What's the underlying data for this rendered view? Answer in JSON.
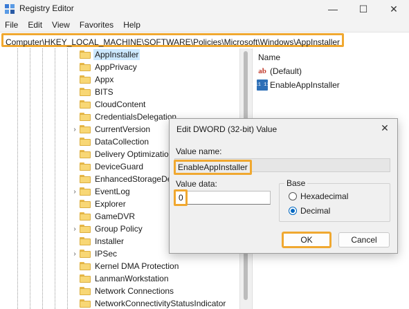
{
  "window": {
    "title": "Registry Editor",
    "minimize_glyph": "—",
    "maximize_glyph": "☐",
    "close_glyph": "✕",
    "icon": "registry-editor-icon"
  },
  "menu": [
    "File",
    "Edit",
    "View",
    "Favorites",
    "Help"
  ],
  "address": "Computer\\HKEY_LOCAL_MACHINE\\SOFTWARE\\Policies\\Microsoft\\Windows\\AppInstaller",
  "tree": {
    "items": [
      {
        "label": "AppInstaller",
        "expander": "",
        "selected": true
      },
      {
        "label": "AppPrivacy",
        "expander": ""
      },
      {
        "label": "Appx",
        "expander": ""
      },
      {
        "label": "BITS",
        "expander": ""
      },
      {
        "label": "CloudContent",
        "expander": ""
      },
      {
        "label": "CredentialsDelegation",
        "expander": ""
      },
      {
        "label": "CurrentVersion",
        "expander": "›"
      },
      {
        "label": "DataCollection",
        "expander": ""
      },
      {
        "label": "Delivery Optimization",
        "expander": ""
      },
      {
        "label": "DeviceGuard",
        "expander": ""
      },
      {
        "label": "EnhancedStorageDevices",
        "expander": ""
      },
      {
        "label": "EventLog",
        "expander": "›"
      },
      {
        "label": "Explorer",
        "expander": ""
      },
      {
        "label": "GameDVR",
        "expander": ""
      },
      {
        "label": "Group Policy",
        "expander": "›"
      },
      {
        "label": "Installer",
        "expander": ""
      },
      {
        "label": "IPSec",
        "expander": "›"
      },
      {
        "label": "Kernel DMA Protection",
        "expander": ""
      },
      {
        "label": "LanmanWorkstation",
        "expander": ""
      },
      {
        "label": "Network Connections",
        "expander": ""
      },
      {
        "label": "NetworkConnectivityStatusIndicator",
        "expander": ""
      }
    ]
  },
  "values": {
    "column_name": "Name",
    "rows": [
      {
        "name": "(Default)",
        "type_icon": "ab",
        "type": "string"
      },
      {
        "name": "EnableAppInstaller",
        "type_icon": "011 110",
        "type": "dword"
      }
    ]
  },
  "dialog": {
    "title": "Edit DWORD (32-bit) Value",
    "close_glyph": "✕",
    "value_name_label": "Value name:",
    "value_name": "EnableAppInstaller",
    "value_data_label": "Value data:",
    "value_data": "0",
    "base_label": "Base",
    "base_options": [
      {
        "label": "Hexadecimal",
        "checked": false
      },
      {
        "label": "Decimal",
        "checked": true
      }
    ],
    "ok_label": "OK",
    "cancel_label": "Cancel"
  },
  "colors": {
    "highlight": "#f0a830",
    "selection": "#cce8ff",
    "accent": "#0067c0"
  }
}
